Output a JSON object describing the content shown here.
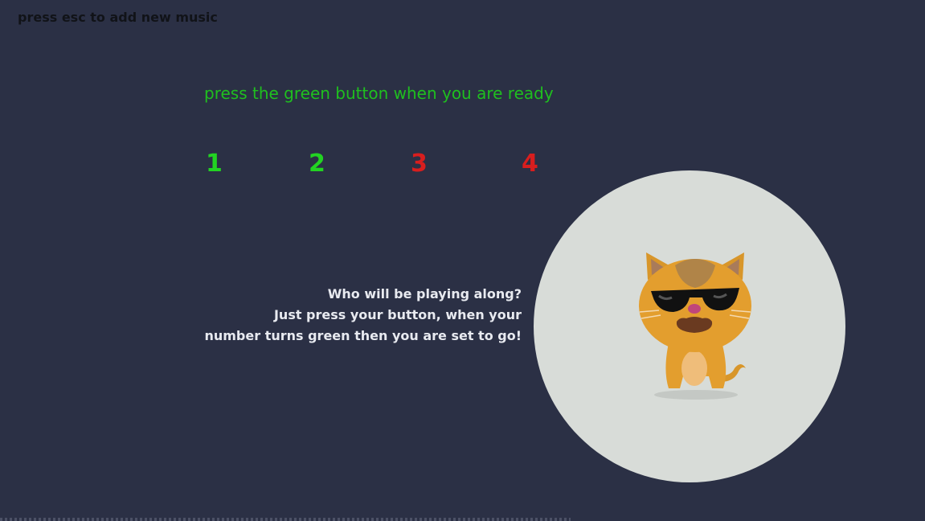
{
  "header": {
    "esc_hint": "press esc to add new music"
  },
  "prompt": {
    "ready_text": "press the green button when you are ready"
  },
  "players": [
    {
      "label": "1",
      "status": "ready",
      "color": "#22d322"
    },
    {
      "label": "2",
      "status": "ready",
      "color": "#22d322"
    },
    {
      "label": "3",
      "status": "not-ready",
      "color": "#d81e1e"
    },
    {
      "label": "4",
      "status": "not-ready",
      "color": "#d81e1e"
    }
  ],
  "instructions": {
    "line1": "Who will be playing along?",
    "line2": "Just press your button, when your",
    "line3": "number turns green then you are set to go!"
  },
  "mascot": {
    "icon": "cool-cat-with-sunglasses-icon"
  },
  "colors": {
    "background": "#2b3045",
    "ready_green": "#22d322",
    "not_ready_red": "#d81e1e",
    "prompt_green": "#1fbf1f",
    "circle": "#d8dcd8"
  }
}
